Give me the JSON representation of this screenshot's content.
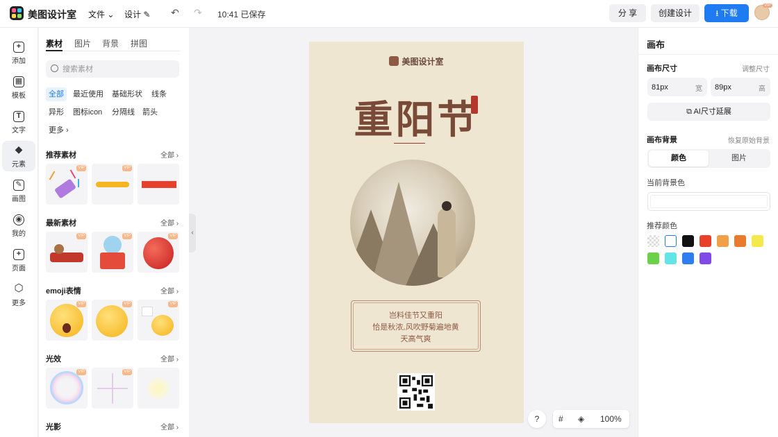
{
  "topbar": {
    "app_title": "美图设计室",
    "file_menu": "文件 ⌄",
    "design_menu": "设计 ✎",
    "save_status": "10:41 已保存",
    "share": "分 享",
    "create": "创建设计",
    "download": "下载",
    "vip_badge": "VIP"
  },
  "rail": [
    {
      "label": "添加",
      "glyph": "+"
    },
    {
      "label": "模板",
      "glyph": "▦"
    },
    {
      "label": "文字",
      "glyph": "T"
    },
    {
      "label": "元素",
      "glyph": "◆"
    },
    {
      "label": "画图",
      "glyph": "✎"
    },
    {
      "label": "我的",
      "glyph": "◉"
    },
    {
      "label": "页面",
      "glyph": "+"
    },
    {
      "label": "更多",
      "glyph": "⬡"
    }
  ],
  "panel": {
    "tabs": [
      "素材",
      "图片",
      "背景",
      "拼图"
    ],
    "search_placeholder": "搜索素材",
    "chips": [
      "全部",
      "最近使用",
      "基础形状",
      "线条",
      "异形",
      "图标icon",
      "分隔线",
      "箭头",
      "更多 ›"
    ],
    "sections": [
      {
        "title": "推荐素材",
        "all": "全部 ›"
      },
      {
        "title": "最新素材",
        "all": "全部 ›"
      },
      {
        "title": "emoji表情",
        "all": "全部 ›"
      },
      {
        "title": "光效",
        "all": "全部 ›"
      },
      {
        "title": "光影",
        "all": "全部 ›"
      }
    ],
    "vip": "VIP"
  },
  "poster": {
    "brand": "美图设计室",
    "title": "重阳节",
    "poem_lines": [
      "岂料佳节又重阳",
      "恰是秋浓,风吹野菊遍地黄",
      "天高气爽"
    ]
  },
  "tools": {
    "help": "?",
    "grid": "#",
    "layers": "◈",
    "zoom": "100%"
  },
  "rpanel": {
    "title": "画布",
    "size_label": "画布尺寸",
    "adjust_size": "调整尺寸",
    "width_value": "81px",
    "width_unit": "宽",
    "height_value": "89px",
    "height_unit": "高",
    "ai_extend": "AI尺寸延展",
    "bg_label": "画布背景",
    "restore_bg": "恢复原始背景",
    "seg_color": "颜色",
    "seg_image": "图片",
    "current_bg": "当前背景色",
    "recommended": "推荐颜色",
    "swatches": [
      "transparent",
      "#ffffff",
      "#111111",
      "#e8402a",
      "#f0a046",
      "#ea7a2e",
      "#f4e94a",
      "#6cd14a",
      "#63e5e8",
      "#2f7ef0",
      "#7f4ae8"
    ]
  }
}
